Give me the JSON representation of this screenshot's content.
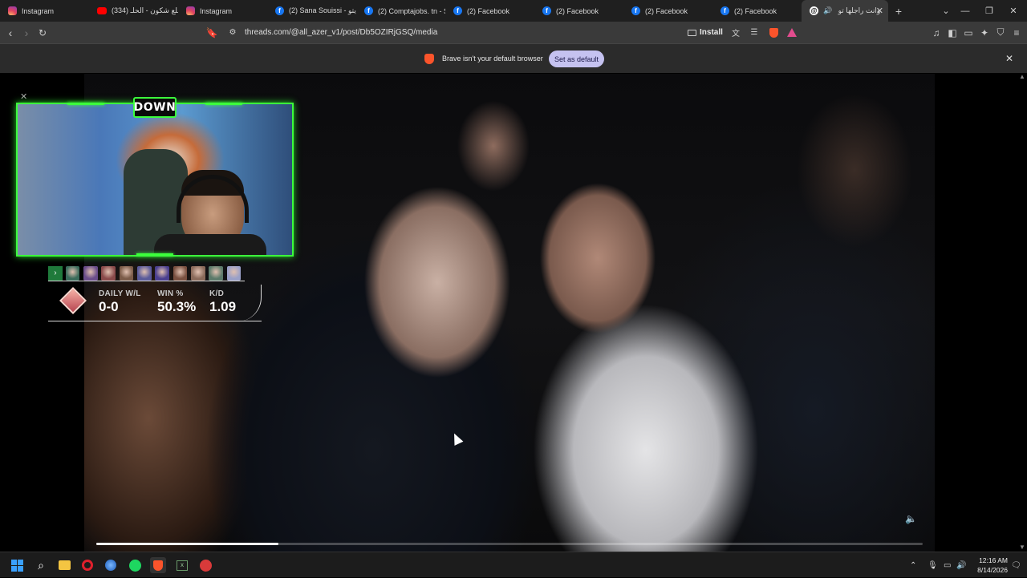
{
  "tabs": [
    {
      "label": "Instagram",
      "icon": "instagram-icon"
    },
    {
      "label": "(334) طلع شكون - الحلـ",
      "icon": "youtube-icon"
    },
    {
      "label": "Instagram",
      "icon": "instagram-icon"
    },
    {
      "label": "(2) Sana Souissi - ديتو",
      "icon": "facebook-icon"
    },
    {
      "label": "(2) Comptajobs. tn - S",
      "icon": "facebook-icon"
    },
    {
      "label": "(2) Facebook",
      "icon": "facebook-icon"
    },
    {
      "label": "(2) Facebook",
      "icon": "facebook-icon"
    },
    {
      "label": "(2) Facebook",
      "icon": "facebook-icon"
    },
    {
      "label": "(2) Facebook",
      "icon": "facebook-icon"
    },
    {
      "label": "وانت راجلها تو",
      "icon": "threads-icon",
      "active": true
    }
  ],
  "toolbar": {
    "url": "threads.com/@all_azer_v1/post/Db5OZIRjGSQ/media",
    "install_label": "Install"
  },
  "notification": {
    "text": "Brave isn't your default browser",
    "button_label": "Set as default"
  },
  "overlay": {
    "badge": "DOWN",
    "stats": [
      {
        "label": "DAILY W/L",
        "value": "0-0"
      },
      {
        "label": "WIN %",
        "value": "50.3%"
      },
      {
        "label": "K/D",
        "value": "1.09"
      }
    ],
    "agent_colors": [
      "#3a6b5a",
      "#6a4c8a",
      "#8a4a4a",
      "#7b5b48",
      "#5a5a9a",
      "#4a3f8f",
      "#7a5040",
      "#8a6a5a",
      "#5b7a6a",
      "#9aa0c8"
    ]
  },
  "video": {
    "progress": 0.22
  },
  "taskbar": {
    "time": "12:16 AM",
    "date": "8/14/2026"
  },
  "colors": {
    "accent_green": "#3cff3c",
    "brave_orange": "#fb542b",
    "set_default_bg": "#c5c2f0"
  }
}
